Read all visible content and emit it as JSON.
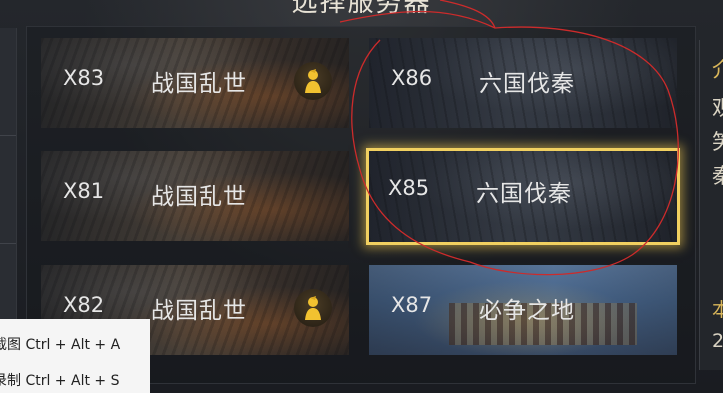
{
  "window": {
    "title": "选择服务器"
  },
  "servers": [
    {
      "number": "X83",
      "name": "战国乱世",
      "has_avatar": true,
      "style": "war",
      "selected": false
    },
    {
      "number": "X86",
      "name": "六国伐秦",
      "has_avatar": false,
      "style": "six",
      "selected": false
    },
    {
      "number": "X81",
      "name": "战国乱世",
      "has_avatar": false,
      "style": "war",
      "selected": false
    },
    {
      "number": "X85",
      "name": "六国伐秦",
      "has_avatar": false,
      "style": "six",
      "selected": true
    },
    {
      "number": "X82",
      "name": "战国乱世",
      "has_avatar": true,
      "style": "war",
      "selected": false
    },
    {
      "number": "X87",
      "name": "必争之地",
      "has_avatar": false,
      "style": "palace",
      "selected": false
    }
  ],
  "side_panel": {
    "chars": [
      "介",
      "观",
      "笑",
      "秦",
      "本",
      "2"
    ]
  },
  "tooltip": {
    "screenshot_shortcut": "截图 Ctrl + Alt + A",
    "record_shortcut": "录制 Ctrl + Alt + S"
  },
  "annotation": {
    "color": "#cc2b2b"
  },
  "colors": {
    "selected_border": "#f1d060",
    "text": "#e6e6e6"
  }
}
